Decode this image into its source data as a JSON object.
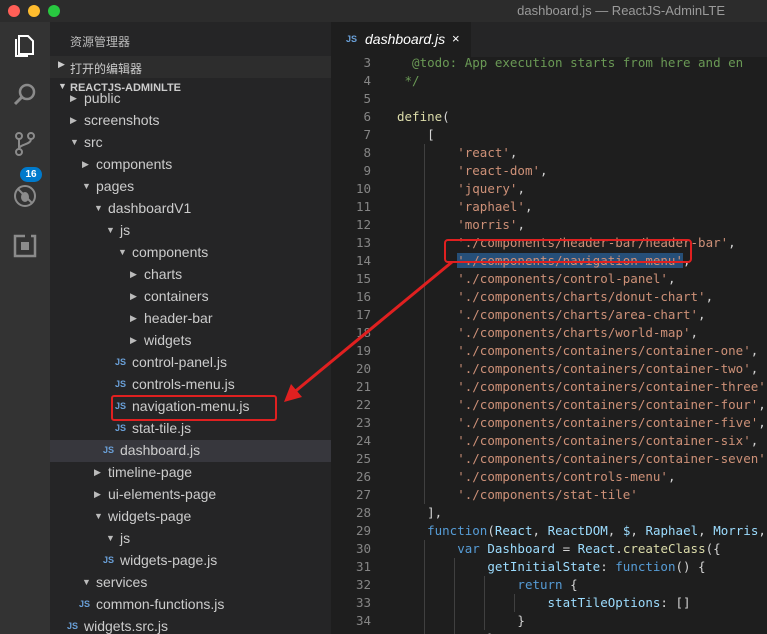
{
  "window": {
    "title": "dashboard.js — ReactJS-AdminLTE",
    "traffic_lights": [
      "#ff5f57",
      "#febc2e",
      "#28c840"
    ]
  },
  "activity_bar": {
    "items": [
      {
        "icon": "files-icon"
      },
      {
        "icon": "search-icon"
      },
      {
        "icon": "source-control-icon",
        "badge": "16"
      },
      {
        "icon": "debug-icon"
      },
      {
        "icon": "extensions-icon"
      }
    ]
  },
  "sidebar": {
    "title": "资源管理器",
    "open_editors": "打开的编辑器",
    "project": "REACTJS-ADMINLTE",
    "tree": [
      {
        "label": "public",
        "kind": "folder",
        "open": false
      },
      {
        "label": "screenshots",
        "kind": "folder",
        "open": false
      },
      {
        "label": "src",
        "kind": "folder",
        "open": true
      },
      {
        "label": "components",
        "kind": "folder",
        "open": false
      },
      {
        "label": "pages",
        "kind": "folder",
        "open": true
      },
      {
        "label": "dashboardV1",
        "kind": "folder",
        "open": true
      },
      {
        "label": "js",
        "kind": "folder",
        "open": true
      },
      {
        "label": "components",
        "kind": "folder",
        "open": true
      },
      {
        "label": "charts",
        "kind": "folder",
        "open": false
      },
      {
        "label": "containers",
        "kind": "folder",
        "open": false
      },
      {
        "label": "header-bar",
        "kind": "folder",
        "open": false
      },
      {
        "label": "widgets",
        "kind": "folder",
        "open": false
      },
      {
        "label": "control-panel.js",
        "kind": "file"
      },
      {
        "label": "controls-menu.js",
        "kind": "file"
      },
      {
        "label": "navigation-menu.js",
        "kind": "file",
        "highlighted": true
      },
      {
        "label": "stat-tile.js",
        "kind": "file"
      },
      {
        "label": "dashboard.js",
        "kind": "file",
        "selected": true
      },
      {
        "label": "timeline-page",
        "kind": "folder",
        "open": false
      },
      {
        "label": "ui-elements-page",
        "kind": "folder",
        "open": false
      },
      {
        "label": "widgets-page",
        "kind": "folder",
        "open": true
      },
      {
        "label": "js",
        "kind": "folder",
        "open": true
      },
      {
        "label": "widgets-page.js",
        "kind": "file"
      },
      {
        "label": "services",
        "kind": "folder",
        "open": true
      },
      {
        "label": "common-functions.js",
        "kind": "file"
      },
      {
        "label": "widgets.src.js",
        "kind": "file"
      }
    ]
  },
  "editor": {
    "tab": {
      "icon_text": "JS",
      "name": "dashboard.js",
      "close": "×"
    },
    "lines": [
      {
        "n": "3",
        "text": "  @todo: App execution starts from here and en"
      },
      {
        "n": "4",
        "text": " */"
      },
      {
        "n": "5",
        "text": ""
      },
      {
        "n": "6",
        "text": "define("
      },
      {
        "n": "7",
        "text": "    ["
      },
      {
        "n": "8",
        "text": "        'react',"
      },
      {
        "n": "9",
        "text": "        'react-dom',"
      },
      {
        "n": "10",
        "text": "        'jquery',"
      },
      {
        "n": "11",
        "text": "        'raphael',"
      },
      {
        "n": "12",
        "text": "        'morris',"
      },
      {
        "n": "13",
        "text": "        './components/header-bar/header-bar',"
      },
      {
        "n": "14",
        "text": "        './components/navigation-menu',",
        "highlighted": true
      },
      {
        "n": "15",
        "text": "        './components/control-panel',"
      },
      {
        "n": "16",
        "text": "        './components/charts/donut-chart',"
      },
      {
        "n": "17",
        "text": "        './components/charts/area-chart',"
      },
      {
        "n": "18",
        "text": "        './components/charts/world-map',"
      },
      {
        "n": "19",
        "text": "        './components/containers/container-one',"
      },
      {
        "n": "20",
        "text": "        './components/containers/container-two',"
      },
      {
        "n": "21",
        "text": "        './components/containers/container-three',"
      },
      {
        "n": "22",
        "text": "        './components/containers/container-four',"
      },
      {
        "n": "23",
        "text": "        './components/containers/container-five',"
      },
      {
        "n": "24",
        "text": "        './components/containers/container-six',"
      },
      {
        "n": "25",
        "text": "        './components/containers/container-seven',"
      },
      {
        "n": "26",
        "text": "        './components/controls-menu',"
      },
      {
        "n": "27",
        "text": "        './components/stat-tile'"
      },
      {
        "n": "28",
        "text": "    ],"
      },
      {
        "n": "29",
        "text": "    function(React, ReactDOM, $, Raphael, Morris, He"
      },
      {
        "n": "30",
        "text": "        var Dashboard = React.createClass({"
      },
      {
        "n": "31",
        "text": "            getInitialState: function() {"
      },
      {
        "n": "32",
        "text": "                return {"
      },
      {
        "n": "33",
        "text": "                    statTileOptions: []"
      },
      {
        "n": "34",
        "text": "                }"
      },
      {
        "n": "35",
        "text": "            },"
      }
    ]
  },
  "colors": {
    "annotation": "#e02020",
    "string": "#ce9178",
    "keyword": "#569cd6",
    "function": "#dcdcaa",
    "variable": "#9cdcfe",
    "class": "#4ec9b0",
    "selection": "#264f78"
  }
}
